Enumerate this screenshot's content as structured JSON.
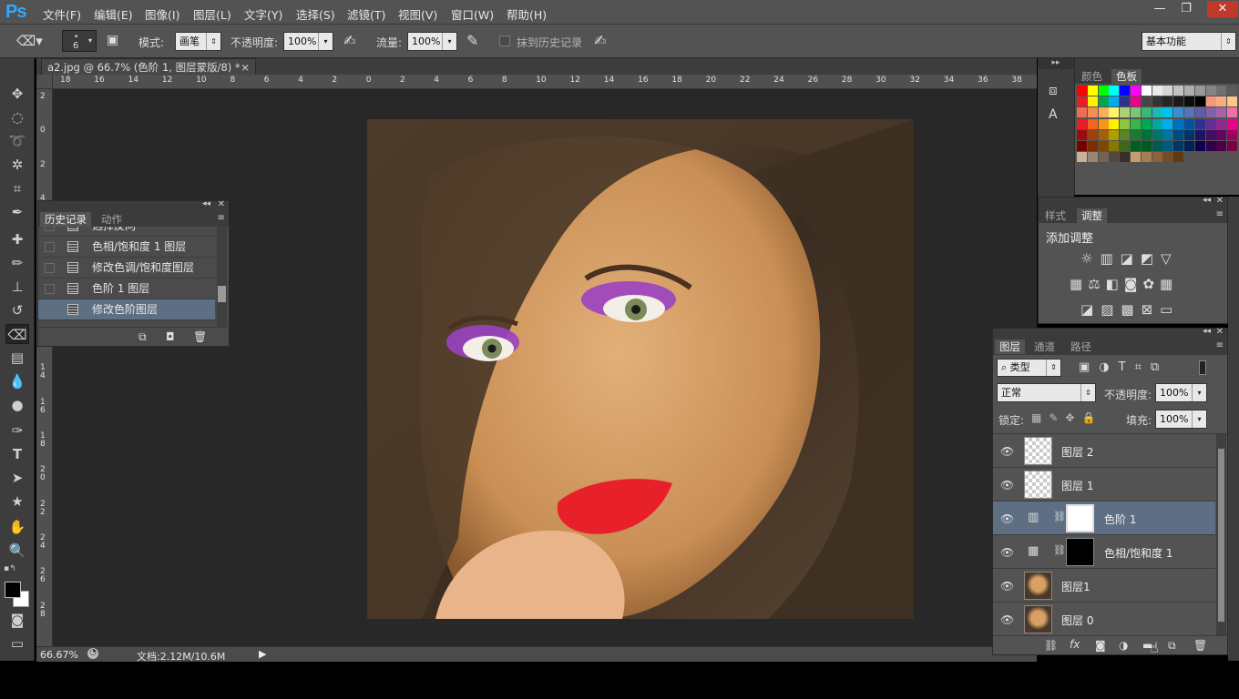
{
  "app": {
    "logo": "Ps"
  },
  "menu": [
    "文件(F)",
    "编辑(E)",
    "图像(I)",
    "图层(L)",
    "文字(Y)",
    "选择(S)",
    "滤镜(T)",
    "视图(V)",
    "窗口(W)",
    "帮助(H)"
  ],
  "window_buttons": {
    "minimize": "—",
    "restore": "❐",
    "close": "✕"
  },
  "options": {
    "brush_size": "6",
    "mode_label": "模式:",
    "mode_value": "画笔",
    "opacity_label": "不透明度:",
    "opacity_value": "100%",
    "flow_label": "流量:",
    "flow_value": "100%",
    "erase_history_label": "抹到历史记录",
    "workspace": "基本功能"
  },
  "document": {
    "tab_title": "a2.jpg @ 66.7% (色阶 1, 图层蒙版/8) *",
    "close": "×"
  },
  "rulers": {
    "h_labels": [
      "18",
      "16",
      "14",
      "12",
      "10",
      "8",
      "6",
      "4",
      "2",
      "0",
      "2",
      "4",
      "6",
      "8",
      "10",
      "12",
      "14",
      "16",
      "18",
      "20",
      "22",
      "24",
      "26",
      "28",
      "30",
      "32",
      "34",
      "36",
      "38"
    ],
    "v_labels": [
      "2",
      "0",
      "2",
      "4",
      "6",
      "8",
      "1 0",
      "1 2",
      "1 4",
      "1 6",
      "1 8",
      "2 0",
      "2 2",
      "2 4",
      "2 6",
      "2 8"
    ]
  },
  "status": {
    "zoom": "66.67%",
    "doc_info": "文档:2.12M/10.6M"
  },
  "history_panel": {
    "tabs": [
      "历史记录",
      "动作"
    ],
    "items": [
      "选择反向",
      "色相/饱和度 1 图层",
      "修改色调/饱和度图层",
      "色阶 1 图层",
      "修改色阶图层"
    ],
    "selected_index": 4
  },
  "swatches_panel": {
    "tabs": [
      "颜色",
      "色板"
    ],
    "active": "色板"
  },
  "adjust_panel": {
    "tabs": [
      "样式",
      "调整"
    ],
    "active": "调整",
    "title": "添加调整"
  },
  "layers_panel": {
    "tabs": [
      "图层",
      "通道",
      "路径"
    ],
    "filter_kind": "类型",
    "blend_mode": "正常",
    "opacity_label": "不透明度:",
    "opacity": "100%",
    "lock_label": "锁定:",
    "fill_label": "填充:",
    "fill": "100%",
    "layers": [
      {
        "name": "图层 2",
        "type": "empty"
      },
      {
        "name": "图层 1",
        "type": "empty"
      },
      {
        "name": "色阶 1",
        "type": "levels",
        "selected": true
      },
      {
        "name": "色相/饱和度 1",
        "type": "huesat"
      },
      {
        "name": "图层1",
        "type": "photo"
      },
      {
        "name": "图层 0",
        "type": "photo"
      }
    ],
    "footer_icons": [
      "link-icon",
      "fx-icon",
      "mask-icon",
      "adjustment-icon",
      "group-folder-icon",
      "new-layer-icon",
      "trash-icon"
    ]
  },
  "colors": {
    "ps_blue": "#31a8ff",
    "panel": "#535353",
    "canvas_bg": "#282828",
    "selected_row": "#5e6f84"
  }
}
